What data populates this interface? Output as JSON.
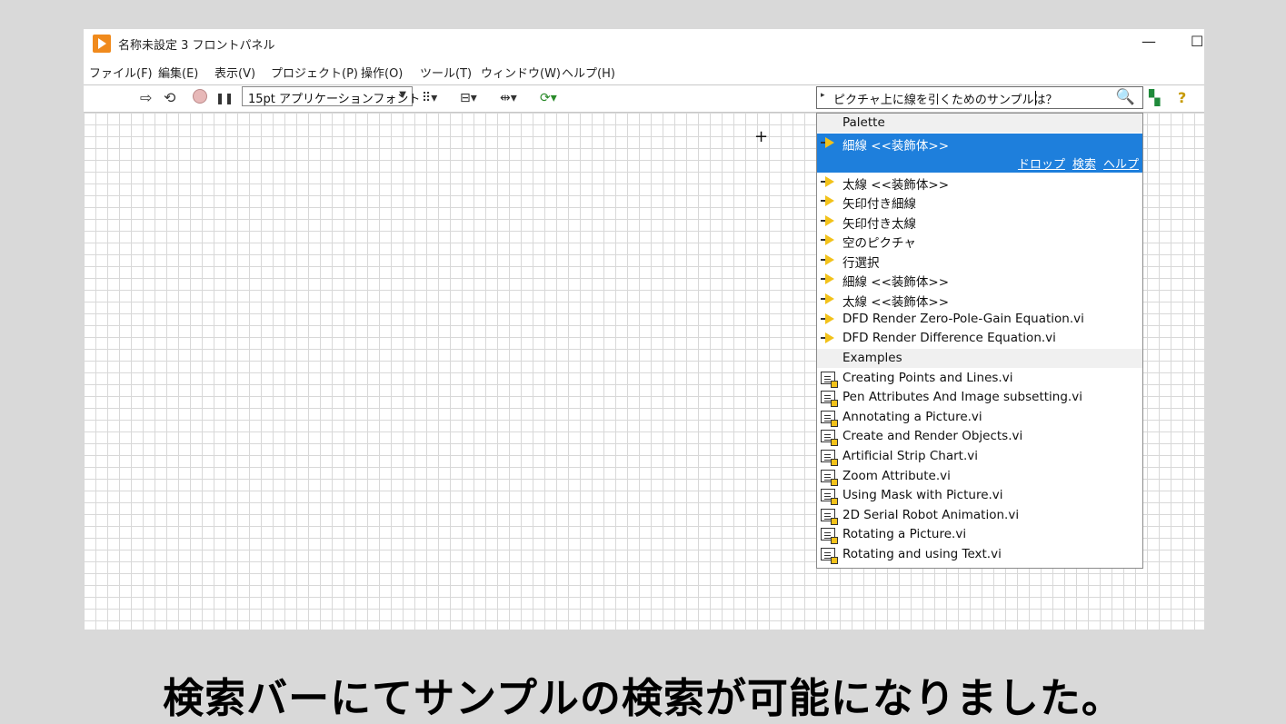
{
  "window": {
    "title": "名称未設定 3 フロントパネル",
    "minimize_glyph": "—",
    "maximize_glyph": "☐"
  },
  "menubar": {
    "items": [
      "ファイル(F)",
      "編集(E)",
      "表示(V)",
      "プロジェクト(P)",
      "操作(O)",
      "ツール(T)",
      "ウィンドウ(W)",
      "ヘルプ(H)"
    ]
  },
  "toolbar": {
    "run_icon": "⇨",
    "run_continuous_icon": "⟲",
    "pause_icon": "❚❚",
    "font_select": "15pt アプリケーションフォント",
    "align_icon": "⠿▾",
    "distribute_icon": "⊟▾",
    "resize_icon": "⇹▾",
    "reorder_icon": "⟳▾",
    "search_value": "ピクチャ上に線を引くためのサンプルは？",
    "context_help_icon": "?",
    "comments_icon": "▚"
  },
  "dropdown": {
    "palette_header": "Palette",
    "selected_actions": [
      "ドロップ",
      "検索",
      "ヘルプ"
    ],
    "palette_items": [
      "細線 <<装飾体>>",
      "太線 <<装飾体>>",
      "矢印付き細線",
      "矢印付き太線",
      "空のピクチャ",
      "行選択",
      "細線 <<装飾体>>",
      "太線 <<装飾体>>",
      "DFD Render Zero-Pole-Gain Equation.vi",
      "DFD Render Difference Equation.vi"
    ],
    "examples_header": "Examples",
    "example_items": [
      "Creating Points and Lines.vi",
      "Pen Attributes And Image subsetting.vi",
      "Annotating a Picture.vi",
      "Create and Render Objects.vi",
      "Artificial Strip Chart.vi",
      "Zoom Attribute.vi",
      "Using Mask with Picture.vi",
      "2D Serial Robot Animation.vi",
      "Rotating a Picture.vi",
      "Rotating and using Text.vi"
    ]
  },
  "caption": "検索バーにてサンプルの検索が可能になりました。",
  "colors": {
    "selection": "#1e7fdc",
    "grid": "#d8d8d8",
    "labview_orange": "#f08a1c"
  }
}
